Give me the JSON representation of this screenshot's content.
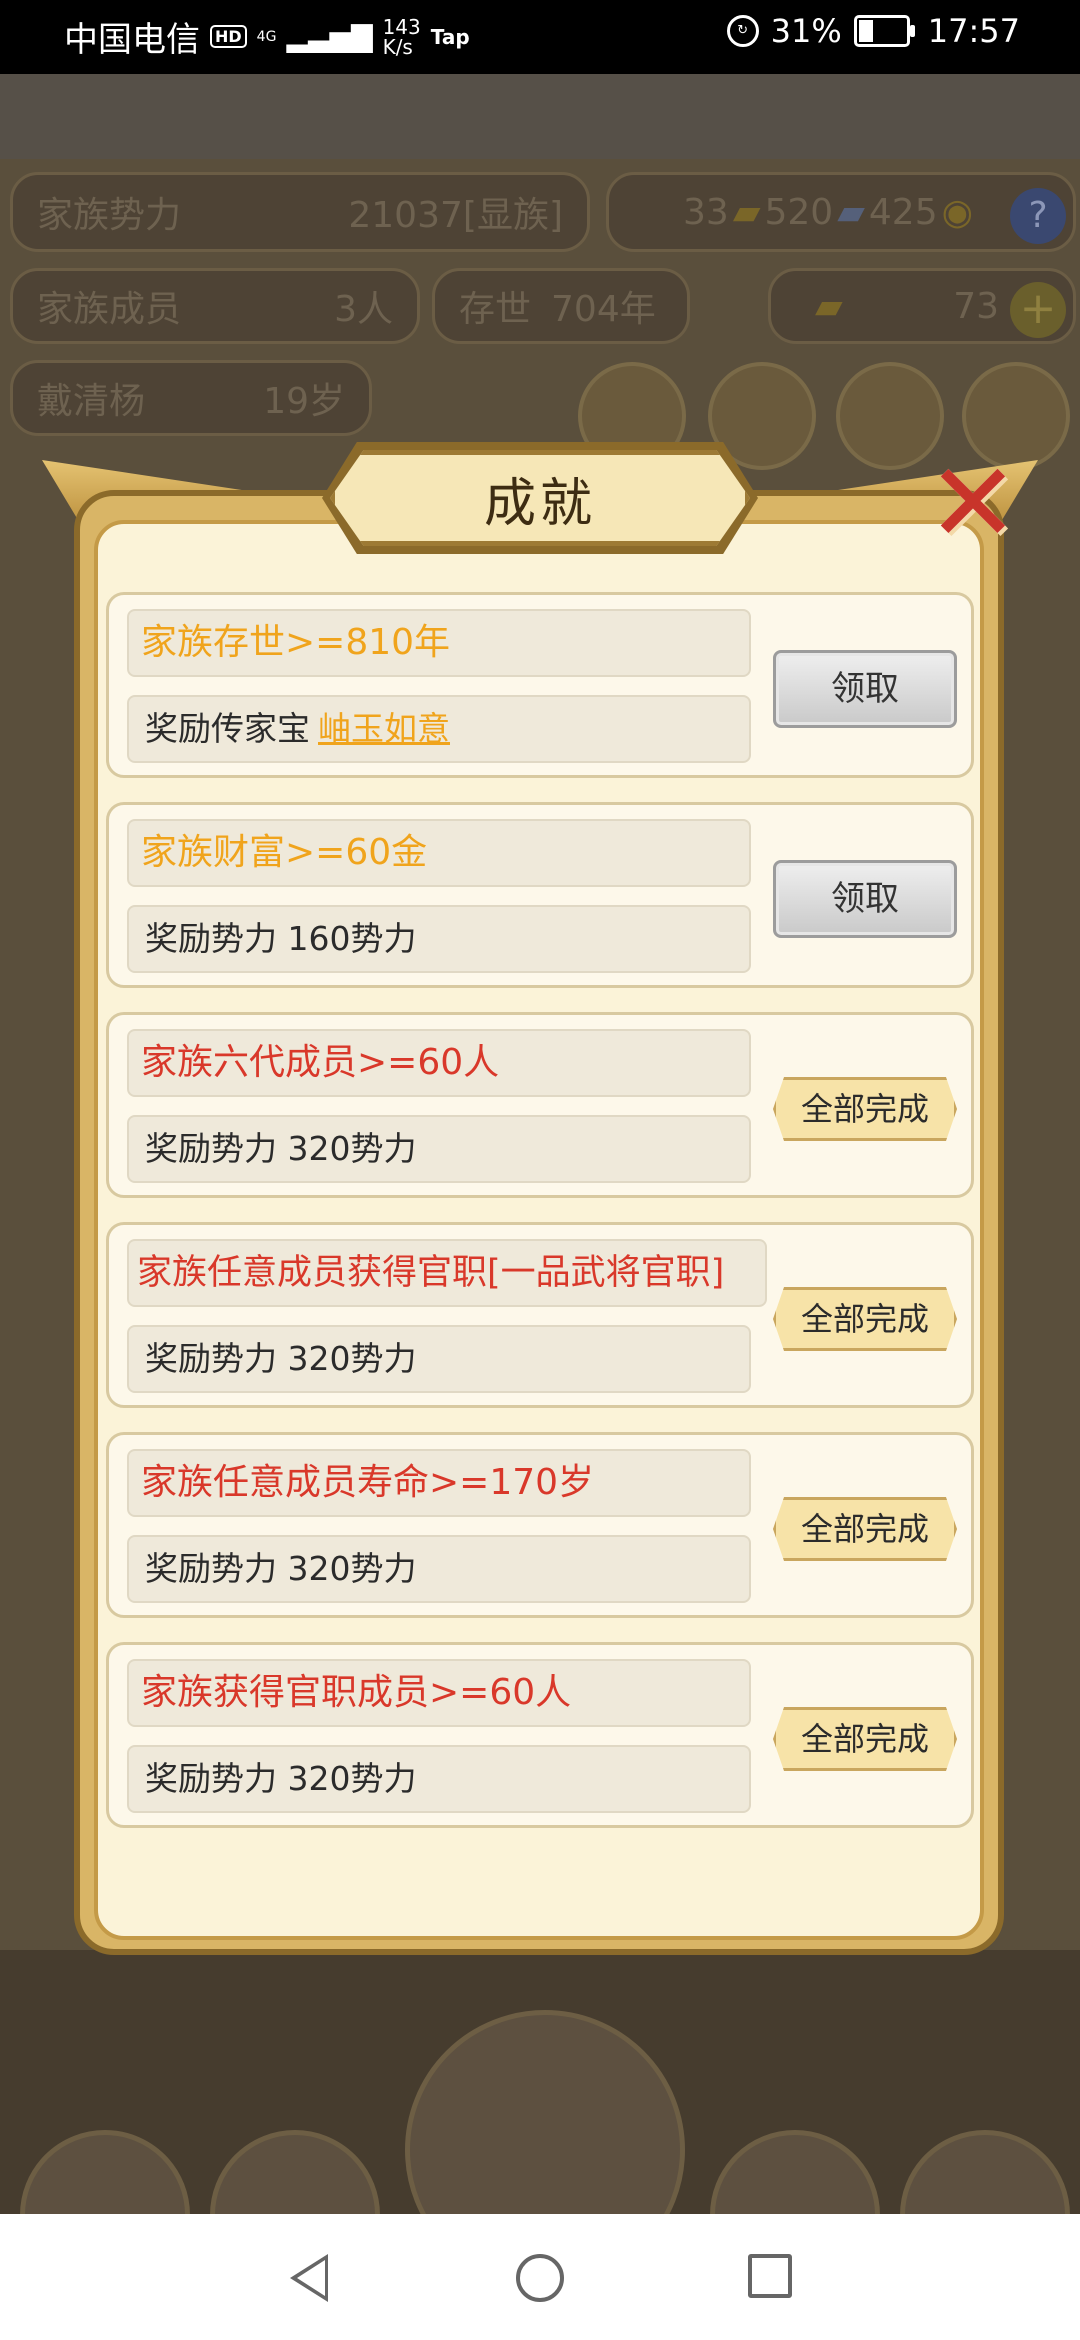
{
  "status_bar": {
    "carrier": "中国电信",
    "hd": "HD",
    "network": "4G",
    "speed_value": "143",
    "speed_unit": "K/s",
    "tap": "Tap",
    "battery": "31%",
    "battery_level": 0.31,
    "time": "17:57"
  },
  "background": {
    "power_label": "家族势力",
    "power_value": "21037[显族]",
    "members_label": "家族成员",
    "members_value": "3人",
    "age_label": "存世",
    "age_value": "704年",
    "leader_name": "戴清杨",
    "leader_age": "19岁",
    "res1": "33",
    "res2": "520",
    "res3": "425",
    "gold": "73",
    "help": "?",
    "plus": "+"
  },
  "dialog": {
    "title": "成就",
    "close": "✕",
    "achievements": [
      {
        "condition": "家族存世>=810年",
        "condition_color": "orange",
        "reward_prefix": "奖励传家宝",
        "reward_item": "岫玉如意",
        "action": "领取",
        "action_type": "claim"
      },
      {
        "condition": "家族财富>=60金",
        "condition_color": "orange",
        "reward_prefix": "奖励势力 160势力",
        "reward_item": "",
        "action": "领取",
        "action_type": "claim"
      },
      {
        "condition": "家族六代成员>=60人",
        "condition_color": "red",
        "reward_prefix": "奖励势力 320势力",
        "reward_item": "",
        "action": "全部完成",
        "action_type": "done"
      },
      {
        "condition": "家族任意成员获得官职[一品武将官职]",
        "condition_color": "red",
        "reward_prefix": "奖励势力 320势力",
        "reward_item": "",
        "action": "全部完成",
        "action_type": "done"
      },
      {
        "condition": "家族任意成员寿命>=170岁",
        "condition_color": "red",
        "reward_prefix": "奖励势力 320势力",
        "reward_item": "",
        "action": "全部完成",
        "action_type": "done"
      },
      {
        "condition": "家族获得官职成员>=60人",
        "condition_color": "red",
        "reward_prefix": "奖励势力 320势力",
        "reward_item": "",
        "action": "全部完成",
        "action_type": "done"
      }
    ]
  },
  "colors": {
    "orange": "#f0a41c",
    "red": "#d9382a"
  },
  "nav": {
    "back_icon": "triangle-back-icon",
    "home_icon": "circle-home-icon",
    "recent_icon": "square-recent-icon"
  }
}
